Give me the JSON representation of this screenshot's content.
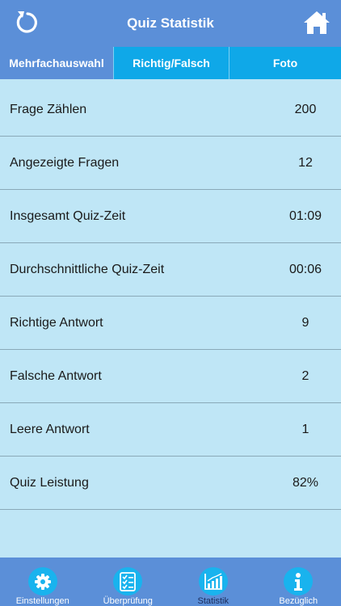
{
  "header": {
    "title": "Quiz Statistik",
    "left_icon": "refresh-icon",
    "right_icon": "home-icon"
  },
  "tabs": [
    {
      "label": "Mehrfachauswahl",
      "active": true
    },
    {
      "label": "Richtig/Falsch",
      "active": false
    },
    {
      "label": "Foto",
      "active": false
    }
  ],
  "stats": [
    {
      "label": "Frage Zählen",
      "value": "200"
    },
    {
      "label": "Angezeigte Fragen",
      "value": "12"
    },
    {
      "label": "Insgesamt Quiz-Zeit",
      "value": "01:09"
    },
    {
      "label": "Durchschnittliche Quiz-Zeit",
      "value": "00:06"
    },
    {
      "label": "Richtige Antwort",
      "value": "9"
    },
    {
      "label": "Falsche Antwort",
      "value": "2"
    },
    {
      "label": "Leere Antwort",
      "value": "1"
    },
    {
      "label": "Quiz Leistung",
      "value": "82%"
    }
  ],
  "bottom_nav": [
    {
      "label": "Einstellungen",
      "icon": "gear-icon"
    },
    {
      "label": "Überprüfung",
      "icon": "checklist-icon"
    },
    {
      "label": "Statistik",
      "icon": "chart-icon",
      "active": true
    },
    {
      "label": "Bezüglich",
      "icon": "info-icon"
    }
  ],
  "colors": {
    "header": "#5b8fd8",
    "tab_bar": "#0fa8e8",
    "background": "#bfe6f6",
    "icon_circle": "#19b3ee"
  }
}
